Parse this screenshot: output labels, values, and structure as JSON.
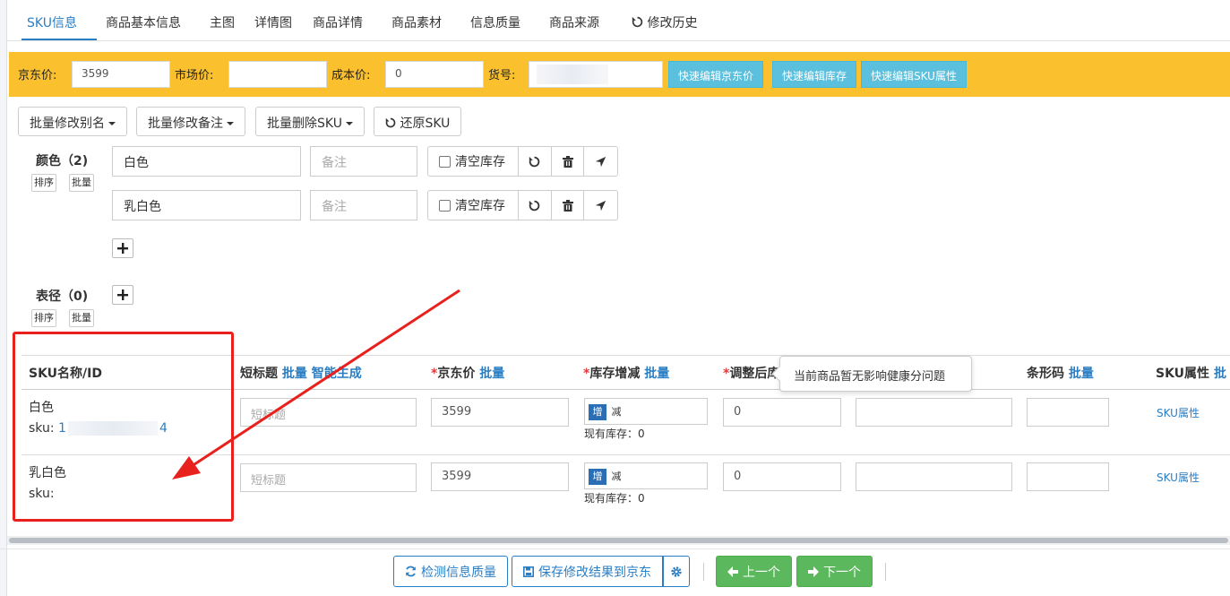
{
  "tabs": [
    {
      "label": "SKU信息"
    },
    {
      "label": "商品基本信息"
    },
    {
      "label": "主图"
    },
    {
      "label": "详情图"
    },
    {
      "label": "商品详情"
    },
    {
      "label": "商品素材"
    },
    {
      "label": "信息质量"
    },
    {
      "label": "商品来源"
    },
    {
      "label": "修改历史"
    }
  ],
  "price_bar": {
    "jd_price_label": "京东价:",
    "jd_price_value": "3599",
    "market_price_label": "市场价:",
    "market_price_value": "",
    "cost_price_label": "成本价:",
    "cost_price_value": "0",
    "item_no_label": "货号:",
    "btn_edit_jd_price": "快速编辑京东价",
    "btn_edit_stock": "快速编辑库存",
    "btn_edit_sku_attr": "快速编辑SKU属性"
  },
  "toolbar": {
    "batch_alias": "批量修改别名",
    "batch_note": "批量修改备注",
    "batch_delete": "批量删除SKU",
    "restore": "还原SKU"
  },
  "color_group": {
    "label": "颜色（2)",
    "sort": "排序",
    "batch": "批量",
    "items": [
      {
        "value": "白色",
        "note_placeholder": "备注",
        "clear_stock": "清空库存"
      },
      {
        "value": "乳白色",
        "note_placeholder": "备注",
        "clear_stock": "清空库存"
      }
    ]
  },
  "diameter_group": {
    "label": "表径（0)",
    "sort": "排序",
    "batch": "批量"
  },
  "table": {
    "headers": {
      "sku_name": "SKU名称/ID",
      "short_title": "短标题",
      "short_title_batch": "批量",
      "short_title_ai": "智能生成",
      "jd_price": "京东价",
      "jd_price_batch": "批量",
      "stock_change": "库存增减",
      "stock_change_batch": "批量",
      "adjusted_stock": "调整后库",
      "barcode": "条形码",
      "barcode_batch": "批量",
      "sku_attr": "SKU属性",
      "sku_attr_batch": "批"
    },
    "rows": [
      {
        "name": "白色",
        "sku_prefix": "sku:",
        "sku_start": "1",
        "sku_end": "4",
        "short_title_placeholder": "短标题",
        "price": "3599",
        "inc": "增",
        "dec": "减",
        "stock_note": "现有库存：0",
        "adjusted": "0",
        "sku_attr": "SKU属性"
      },
      {
        "name": "乳白色",
        "sku_prefix": "sku:",
        "sku_start": "",
        "sku_end": "",
        "short_title_placeholder": "短标题",
        "price": "3599",
        "inc": "增",
        "dec": "减",
        "stock_note": "现有库存：0",
        "adjusted": "0",
        "sku_attr": "SKU属性"
      }
    ]
  },
  "tooltip": "当前商品暂无影响健康分问题",
  "footer": {
    "check_quality": "检测信息质量",
    "save_to_jd": "保存修改结果到京东",
    "prev": "上一个",
    "next": "下一个"
  },
  "colors": {
    "accent": "#2a7ec4",
    "bar_yellow": "#fbc02d",
    "info_button": "#5bc0de",
    "success_button": "#5cb85c",
    "highlight_red": "#e8211d"
  }
}
